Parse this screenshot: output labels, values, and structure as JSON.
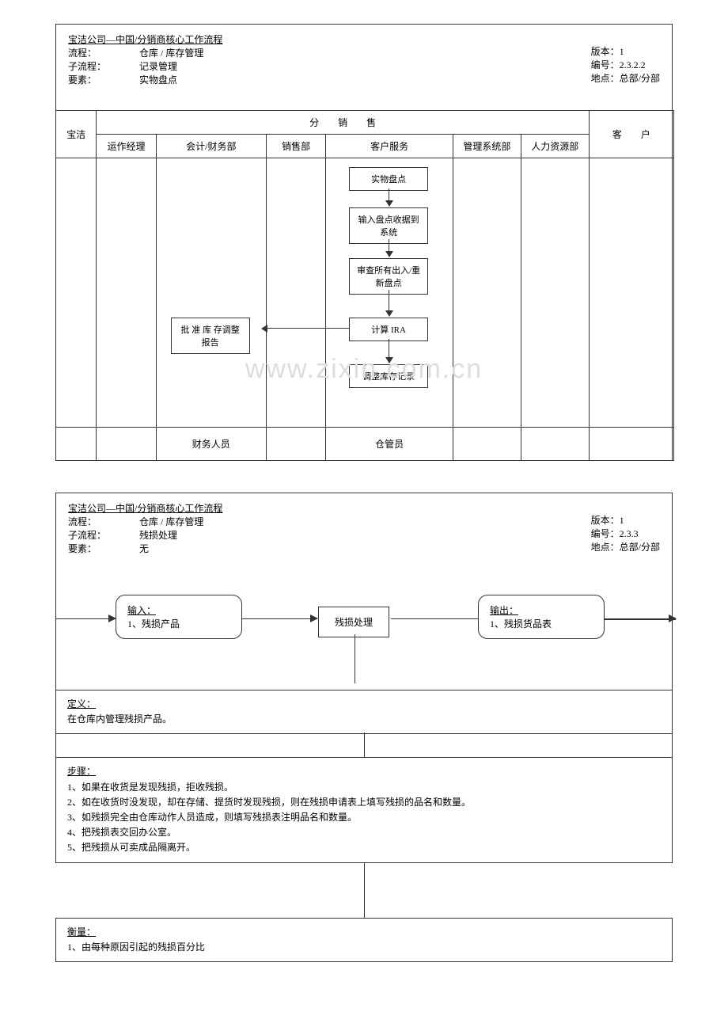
{
  "block1": {
    "title": "宝洁公司—中国/分销商核心工作流程",
    "meta": {
      "flow_label": "流程：",
      "flow_value": "仓库 / 库存管理",
      "sub_label": "子流程：",
      "sub_value": "记录管理",
      "elem_label": "要素：",
      "elem_value": "实物盘点",
      "ver_label": "版本：",
      "ver_value": "1",
      "no_label": "编号：",
      "no_value": "2.3.2.2",
      "loc_label": "地点：",
      "loc_value": "总部/分部"
    },
    "columns": {
      "baojie": "宝洁",
      "dist_header": "分　　销　　售",
      "ops": "运作经理",
      "acct": "会计/财务部",
      "sales": "销售部",
      "cs": "客户服务",
      "mis": "管理系统部",
      "hr": "人力资源部",
      "cust": "客　　户"
    },
    "nodes": {
      "n1": "实物盘点",
      "n2": "输入盘点收据到系统",
      "n3": "审查所有出入/重新盘点",
      "n4": "计算 IRA",
      "n5": "调整库存记录",
      "n6": "批 准 库 存调整报告"
    },
    "footer": {
      "acct": "财务人员",
      "cs": "仓管员"
    },
    "watermark": "www.zixin.com.cn"
  },
  "block2": {
    "title": "宝洁公司—中国/分销商核心工作流程",
    "meta": {
      "flow_label": "流程：",
      "flow_value": "仓库 / 库存管理",
      "sub_label": "子流程：",
      "sub_value": "残损处理",
      "elem_label": "要素：",
      "elem_value": "无",
      "ver_label": "版本：",
      "ver_value": "1",
      "no_label": "编号：",
      "no_value": "2.3.3",
      "loc_label": "地点：",
      "loc_value": "总部/分部"
    },
    "flow": {
      "input_title": "输入：",
      "input_item": "1、残损产品",
      "process": "残损处理",
      "output_title": "输出：",
      "output_item": "1、残损货品表"
    },
    "definition": {
      "title": "定义：",
      "text": "在仓库内管理残损产品。"
    },
    "steps": {
      "title": "步骤：",
      "s1": "1、如果在收货是发现残损，拒收残损。",
      "s2": "2、如在收货时没发现，却在存储、提货时发现残损，则在残损申请表上填写残损的品名和数量。",
      "s3": "3、如残损完全由仓库动作人员造成，则填写残损表注明品名和数量。",
      "s4": "4、把残损表交回办公室。",
      "s5": "5、把残损从可卖成品隔离开。"
    },
    "measure": {
      "title": "衡量：",
      "m1": "1、由每种原因引起的残损百分比"
    }
  }
}
